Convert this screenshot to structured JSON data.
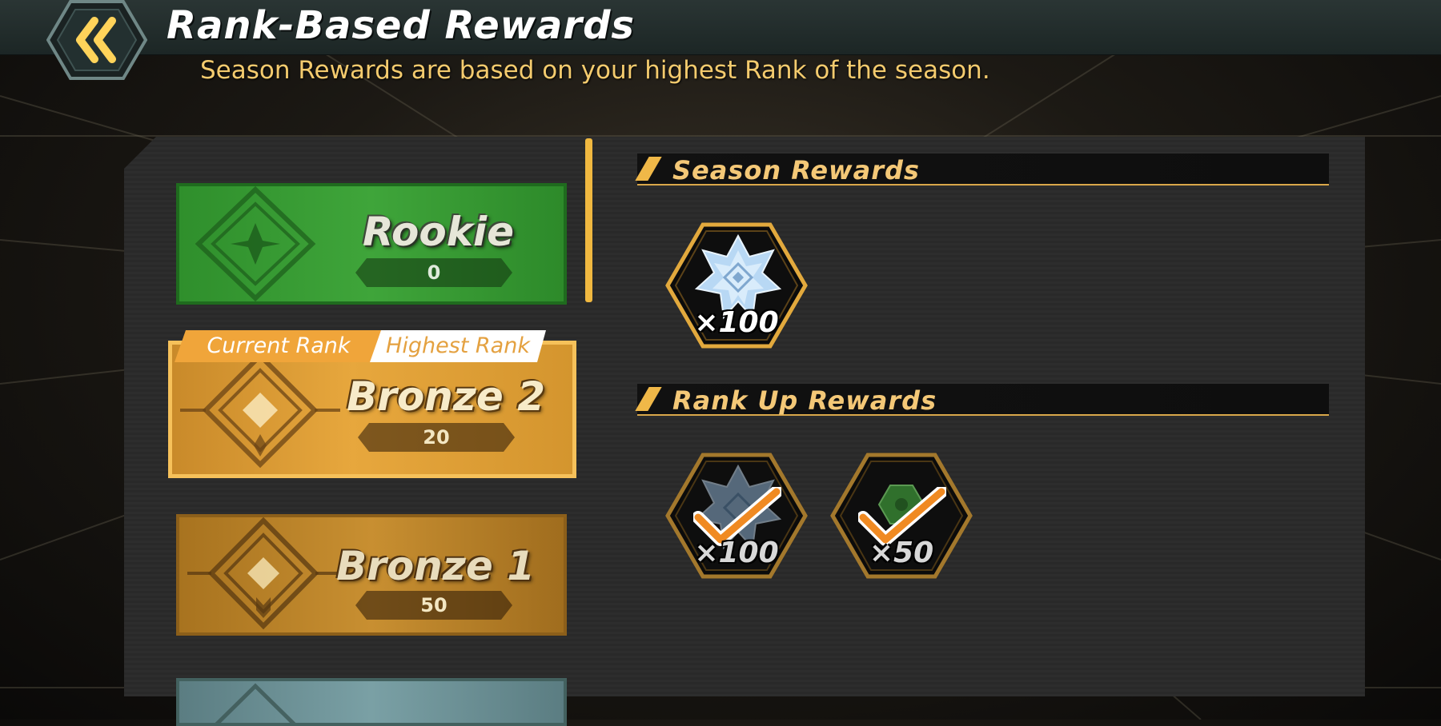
{
  "header": {
    "title": "Rank-Based Rewards",
    "subtitle": "Season Rewards are based on your highest Rank of the season."
  },
  "ranks": [
    {
      "name": "Rookie",
      "points": "0"
    },
    {
      "name": "Bronze 2",
      "points": "20",
      "tab_current": "Current Rank",
      "tab_highest": "Highest Rank"
    },
    {
      "name": "Bronze 1",
      "points": "50"
    }
  ],
  "season_rewards": {
    "heading": "Season Rewards",
    "items": [
      {
        "icon": "crystal-gem-icon",
        "qty": "×100",
        "claimed": false
      }
    ]
  },
  "rank_up_rewards": {
    "heading": "Rank Up Rewards",
    "items": [
      {
        "icon": "crystal-gem-icon",
        "qty": "×100",
        "claimed": true
      },
      {
        "icon": "green-token-icon",
        "qty": "×50",
        "claimed": true
      }
    ]
  },
  "colors": {
    "accent_gold": "#f4c877",
    "rookie_green": "#3fa53a",
    "bronze_orange": "#e7a73d",
    "check_orange": "#f08a22"
  }
}
